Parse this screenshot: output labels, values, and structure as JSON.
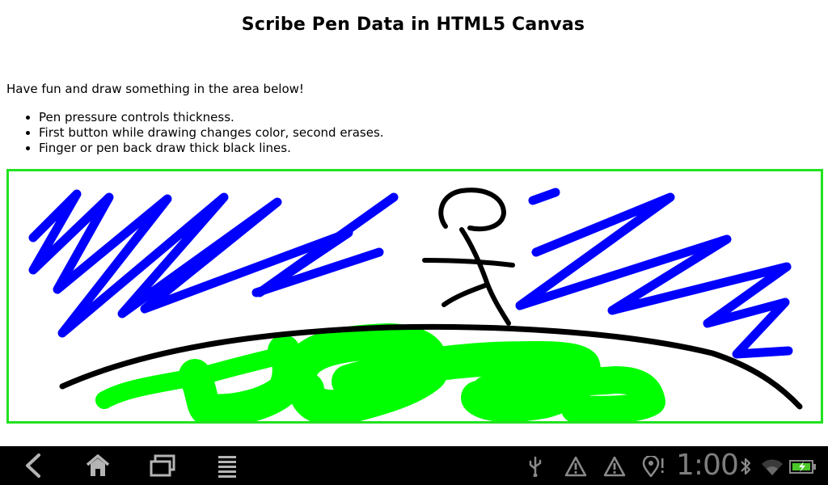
{
  "page": {
    "title": "Scribe Pen Data in HTML5 Canvas",
    "intro": "Have fun and draw something in the area below!",
    "tips": [
      "Pen pressure controls thickness.",
      "First button while drawing changes color, second erases.",
      "Finger or pen back draw thick black lines."
    ]
  },
  "canvas": {
    "border_color": "#21e21f",
    "stroke_colors": [
      "#0000ff",
      "#000000",
      "#00ff00"
    ]
  },
  "navbar": {
    "buttons": [
      "back-icon",
      "home-icon",
      "recent-apps-icon",
      "menu-icon"
    ],
    "status_icons": [
      "usb-icon",
      "warning-icon",
      "warning-icon",
      "location-icon",
      "bluetooth-icon",
      "wifi-icon",
      "battery-icon"
    ],
    "clock": "1:00"
  }
}
